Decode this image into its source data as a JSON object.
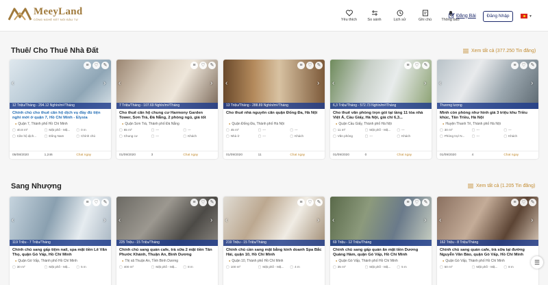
{
  "brand": {
    "name": "MeeyLand",
    "tagline": "CÔNG NGHỆ KẾT NỐI ĐẦU TƯ"
  },
  "nav": [
    {
      "label": "Yêu thích",
      "icon": "heart-icon"
    },
    {
      "label": "So sánh",
      "icon": "compare-icon"
    },
    {
      "label": "Lịch sử",
      "icon": "history-icon"
    },
    {
      "label": "Ghi chú",
      "icon": "note-icon"
    },
    {
      "label": "Thông báo",
      "icon": "bell-icon"
    }
  ],
  "post_label": "Đăng Bài",
  "login_label": "Đăng Nhập",
  "sections": [
    {
      "title": "Thuê/ Cho Thuê Nhà Đất",
      "view_all": "Xem tất cả (377.250 Tin đăng)",
      "cards": [
        {
          "price": "12 Triệu/Tháng - 294.12 Nghìn/m²/Tháng",
          "title": "Chính chủ cho thuê căn hộ dịch vụ đầy đủ tiện nghi mới ở quận 7, Hồ Chí Minh - Elysia",
          "highlight": true,
          "location": "Quận 7, Thành phố Hồ Chí Minh",
          "attrs": [
            "40.8 m²",
            "Mặt phố - Mặ...",
            "0 m",
            "Căn hộ dịch...",
            "Đông Nam",
            "Chính chủ"
          ],
          "date": "05/08/2020",
          "views": "1,246",
          "chat": "Chat ngay"
        },
        {
          "price": "7 Triệu/Tháng - 107.69 Nghìn/m²/Tháng",
          "title": "Cho thuê căn hộ chung cư Harmony Garden Tower, Sơn Trà, Đà Nẵng, 2 phòng ngủ, giá tốt",
          "highlight": false,
          "location": "Quận Sơn Trà, Thành phố Đà Nẵng",
          "attrs": [
            "65 m²",
            "---",
            "---",
            "Chung cư",
            "---",
            "Khách"
          ],
          "date": "01/09/2020",
          "views": "3",
          "chat": "Chat ngay"
        },
        {
          "price": "13 Triệu/Tháng - 288.89 Nghìn/m²/Tháng",
          "title": "Cho thuê nhà nguyên căn quận Đống Đa, Hà Nội",
          "highlight": false,
          "location": "Quận Đống Đa, Thành phố Hà Nội",
          "attrs": [
            "45 m²",
            "---",
            "---",
            "Nhà ở",
            "---",
            "Khách"
          ],
          "date": "01/09/2020",
          "views": "11",
          "chat": "Chat ngay"
        },
        {
          "price": "6,3 Triệu/Tháng - 572.73 Nghìn/m²/Tháng",
          "title": "Cho thuê văn phòng trọn gói tại tầng 11 tòa nhà Việt Á, Cầu Giấy, Hà Nội, giá chỉ 6,3...",
          "highlight": false,
          "location": "Quận Cầu Giấy, Thành phố Hà Nội",
          "attrs": [
            "11 m²",
            "Mặt phố - Mặ...",
            "---",
            "Văn phòng",
            "---",
            "Khách"
          ],
          "date": "01/09/2020",
          "views": "0",
          "chat": "Chat ngay"
        },
        {
          "price": "Thương lượng",
          "title": "Mình còn phòng như hình giá 3 triệu khu Triều khúc, Tân Triều, Hà Nội",
          "highlight": false,
          "location": "Huyện Thanh Trì, Thành phố Hà Nội",
          "attrs": [
            "30 m²",
            "---",
            "---",
            "Phòng trọ/ N...",
            "---",
            "Khách"
          ],
          "date": "01/09/2020",
          "views": "4",
          "chat": "Chat ngay"
        }
      ]
    },
    {
      "title": "Sang Nhượng",
      "view_all": "Xem tất cả (1.205 Tin đăng)",
      "cards": [
        {
          "price": "119 Triệu - 7 Triệu/Tháng",
          "title": "Chính chủ sang gấp tiệm nail, spa mặt tiền Lê Văn Thọ, quận Gò Vấp, Hồ Chí Minh",
          "highlight": false,
          "location": "Quận Gò Vấp, Thành phố Hồ Chí Minh",
          "attrs": [
            "30 m²",
            "Mặt phố - Mặ...",
            "5 m"
          ]
        },
        {
          "price": "225 Triệu - 15 Triệu/Tháng",
          "title": "Chính chủ sang quán cafe, trà sữa 2 mặt tiền Tân Phước Khánh, Thuận An, Bình Dương",
          "highlight": false,
          "location": "Thị xã Thuận An, Tỉnh Bình Dương",
          "attrs": [
            "400 m²",
            "Mặt phố - Mặ...",
            "8 m"
          ]
        },
        {
          "price": "219 Triệu - 15 Triệu/Tháng",
          "title": "Chính chủ cần sang mặt bằng kinh doanh Spa Bắc Hải, quận 10, Hồ Chí Minh",
          "highlight": false,
          "location": "Quận 10, Thành phố Hồ Chí Minh",
          "attrs": [
            "100 m²",
            "Mặt phố - Mặ...",
            "4 m"
          ]
        },
        {
          "price": "69 Triệu - 12 Triệu/Tháng",
          "title": "Chính chủ sang gấp quán ăn mặt tiền Dương Quảng Hàm, quận Gò Vấp, Hồ Chí Minh",
          "highlight": false,
          "location": "Quận Gò Vấp, Thành phố Hồ Chí Minh",
          "attrs": [
            "35 m²",
            "Mặt phố - Mặ...",
            "5 m"
          ]
        },
        {
          "price": "162 Triệu - 8 Triệu/Tháng",
          "title": "Chính chủ sang quán cafe, trà sữa tại đường Nguyễn Văn Bảo, quận Gò Vấp, Hồ Chí Minh",
          "highlight": false,
          "location": "Quận Gò Vấp, Thành phố Hồ Chí Minh",
          "attrs": [
            "50 m²",
            "Mặt phố - Mặ...",
            "8 m"
          ]
        }
      ]
    }
  ],
  "colors": {
    "accent": "#c28a2e",
    "primary": "#1d2a6b",
    "price_bar": "#1e3c8c"
  }
}
